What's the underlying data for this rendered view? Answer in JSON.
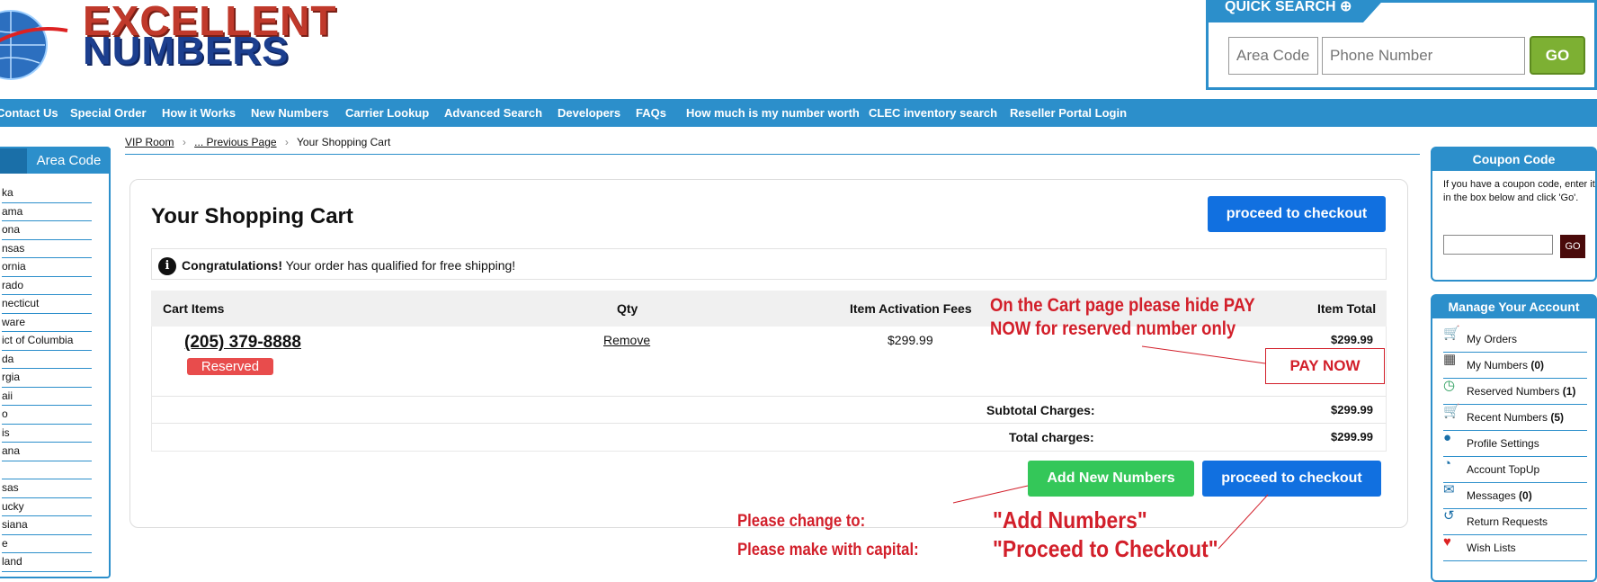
{
  "logo": {
    "line1": "EXCELLENT",
    "line2": "NUMBERS"
  },
  "quick_search": {
    "title": "QUICK SEARCH",
    "area_code_placeholder": "Area Code",
    "phone_placeholder": "Phone Number",
    "go_label": "GO"
  },
  "nav": {
    "items": [
      "Contact Us",
      "Special Order",
      "How it Works",
      "New Numbers",
      "Carrier Lookup",
      "Advanced Search",
      "Developers",
      "FAQs",
      "How much is my number worth",
      "CLEC inventory search",
      "Reseller Portal Login"
    ]
  },
  "left_panel": {
    "tab_area_code": "Area Code",
    "states": [
      "ka",
      "ama",
      "ona",
      "nsas",
      "ornia",
      "rado",
      "necticut",
      "ware",
      "ict of Columbia",
      "da",
      "rgia",
      "aii",
      "o",
      "is",
      "ana",
      "",
      "sas",
      "ucky",
      "siana",
      "e",
      "land"
    ]
  },
  "breadcrumb": {
    "items": [
      "VIP Room",
      "... Previous Page",
      "Your Shopping Cart"
    ]
  },
  "cart": {
    "title": "Your Shopping Cart",
    "checkout_top": "proceed to checkout",
    "notice_bold": "Congratulations!",
    "notice_text": " Your order has qualified for free shipping!",
    "headers": {
      "items": "Cart Items",
      "qty": "Qty",
      "fees": "Item Activation Fees",
      "total": "Item Total"
    },
    "row": {
      "phone": "(205) 379-8888",
      "status": "Reserved",
      "remove": "Remove",
      "fee": "$299.99",
      "total": "$299.99",
      "pay_now": "PAY NOW"
    },
    "subtotal_label": "Subtotal Charges:",
    "subtotal_value": "$299.99",
    "total_label": "Total charges:",
    "total_value": "$299.99",
    "add_numbers": "Add New Numbers",
    "checkout_bottom": "proceed to checkout"
  },
  "annotations": {
    "note1_line1": "On the Cart page please hide PAY",
    "note1_line2": "NOW for reserved number only",
    "change_to": "Please change to:",
    "capital": "Please make with capital:",
    "add_numbers": "\"Add Numbers\"",
    "proceed": "\"Proceed to Checkout\""
  },
  "coupon": {
    "title": "Coupon Code",
    "text": "If you have a coupon code, enter it in the box below and click 'Go'.",
    "go": "GO"
  },
  "account": {
    "title": "Manage Your Account",
    "items": [
      {
        "label": "My Orders",
        "count": "",
        "icon": "cart-icon"
      },
      {
        "label": "My Numbers",
        "count": "(0)",
        "icon": "grid-icon"
      },
      {
        "label": "Reserved Numbers",
        "count": "(1)",
        "icon": "clock-icon"
      },
      {
        "label": "Recent Numbers",
        "count": "(5)",
        "icon": "cart-icon"
      },
      {
        "label": "Profile Settings",
        "count": "",
        "icon": "user-icon"
      },
      {
        "label": "Account TopUp",
        "count": "",
        "icon": "chart-icon"
      },
      {
        "label": "Messages",
        "count": "(0)",
        "icon": "message-icon"
      },
      {
        "label": "Return Requests",
        "count": "",
        "icon": "return-icon"
      },
      {
        "label": "Wish Lists",
        "count": "",
        "icon": "heart-icon"
      }
    ]
  },
  "colors": {
    "brand_blue": "#2c8fcb",
    "button_blue": "#1170e0",
    "green": "#34c759",
    "annotation_red": "#d21f2a"
  }
}
